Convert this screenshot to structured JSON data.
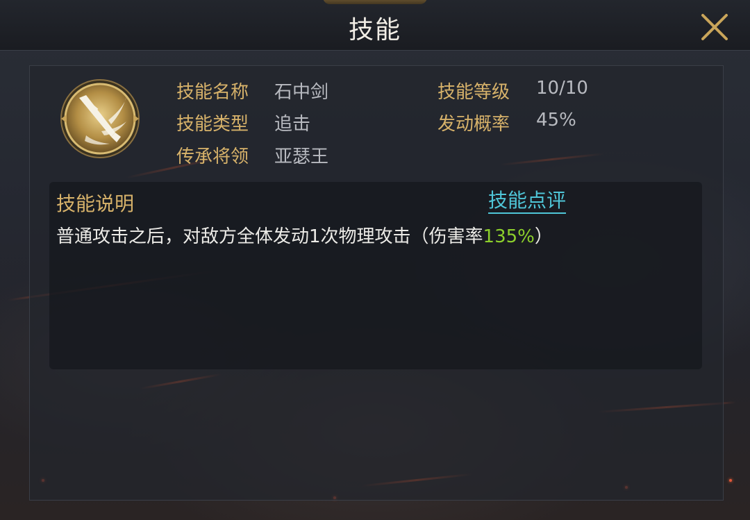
{
  "window": {
    "title": "技能"
  },
  "skill": {
    "icon": "sword-icon",
    "name_label": "技能名称",
    "name_value": "石中剑",
    "level_label": "技能等级",
    "level_value": "10/10",
    "type_label": "技能类型",
    "type_value": "追击",
    "rate_label": "发动概率",
    "rate_value": "45%",
    "heir_label": "传承将领",
    "heir_value": "亚瑟王"
  },
  "description": {
    "title": "技能说明",
    "review_link": "技能点评",
    "text_prefix": "普通攻击之后，对敌方全体发动1次物理攻击（伤害率",
    "text_highlight": "135%",
    "text_suffix": "）"
  },
  "colors": {
    "label": "#d7b26a",
    "value": "#b8bac0",
    "link": "#4fc6d8",
    "highlight": "#8ccf2c",
    "emblem_gold": "#c9a55a"
  }
}
